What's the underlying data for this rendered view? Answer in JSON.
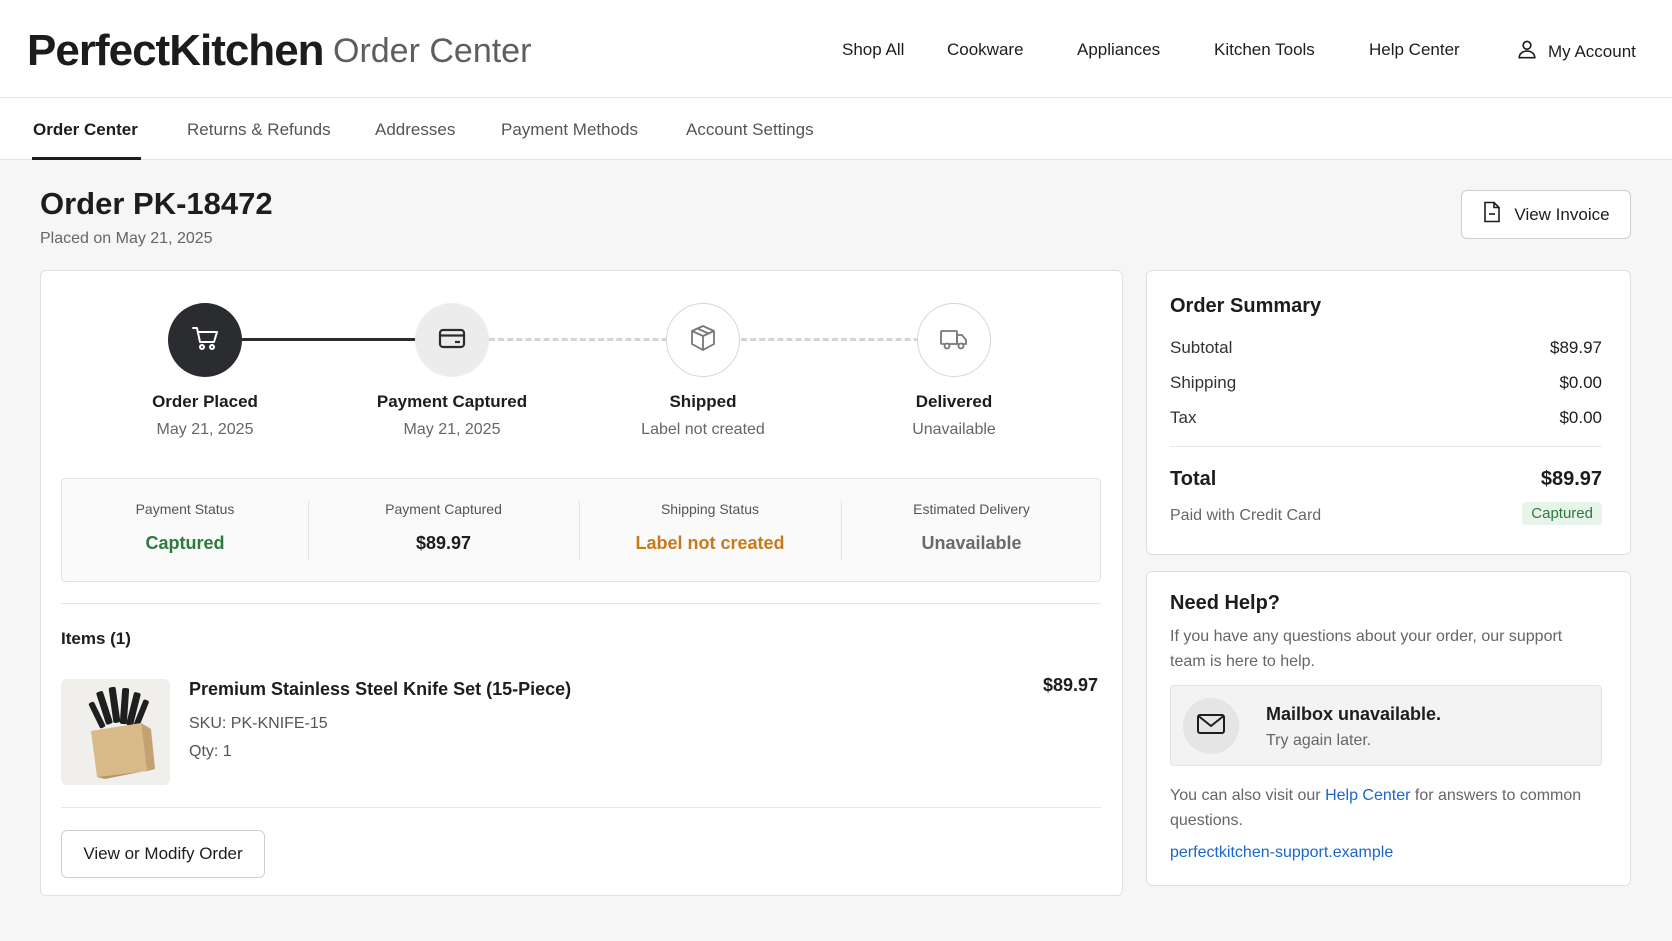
{
  "header": {
    "brand": "PerfectKitchen",
    "brand_sub": "Order Center",
    "nav": [
      "Shop All",
      "Cookware",
      "Appliances",
      "Kitchen Tools",
      "Help Center"
    ],
    "account_label": "My Account",
    "account_icon": "user-icon"
  },
  "subnav": {
    "tabs": [
      "Order Center",
      "Returns & Refunds",
      "Addresses",
      "Payment Methods",
      "Account Settings"
    ],
    "active": "Order Center"
  },
  "order": {
    "title": "Order PK-18472",
    "placed": "Placed on May 21, 2025",
    "invoice_label": "View Invoice"
  },
  "tracker": {
    "steps": [
      {
        "label": "Order Placed",
        "sub": "May 21, 2025",
        "icon": "cart-icon",
        "state": "done"
      },
      {
        "label": "Payment Captured",
        "sub": "May 21, 2025",
        "icon": "credit-card-icon",
        "state": "current"
      },
      {
        "label": "Shipped",
        "sub": "Label not created",
        "icon": "box-icon",
        "state": "pending"
      },
      {
        "label": "Delivered",
        "sub": "Unavailable",
        "icon": "truck-icon",
        "state": "pending"
      }
    ]
  },
  "status": [
    {
      "label": "Payment Status",
      "value": "Captured",
      "color": "#2d7a3e"
    },
    {
      "label": "Payment Captured",
      "value": "$89.97",
      "color": "#1d1d1f"
    },
    {
      "label": "Shipping Status",
      "value": "Label not created",
      "color": "#c87a1a"
    },
    {
      "label": "Estimated Delivery",
      "value": "Unavailable",
      "color": "#6a6a6a"
    }
  ],
  "items": {
    "heading": "Items (1)",
    "list": [
      {
        "name": "Premium Stainless Steel Knife Set (15-Piece)",
        "sku": "SKU: PK-KNIFE-15",
        "qty": "Qty: 1",
        "price": "$89.97"
      }
    ],
    "modify_label": "View or Modify Order"
  },
  "summary": {
    "title": "Order Summary",
    "rows": [
      {
        "label": "Subtotal",
        "value": "$89.97"
      },
      {
        "label": "Shipping",
        "value": "$0.00"
      },
      {
        "label": "Tax",
        "value": "$0.00"
      }
    ],
    "total_label": "Total",
    "total_value": "$89.97",
    "paid_with": "Paid with Credit Card",
    "badge": "Captured"
  },
  "help": {
    "title": "Need Help?",
    "text": "If you have any questions about your order, our support team is here to help.",
    "mailbox_title": "Mailbox unavailable.",
    "mailbox_sub": "Try again later.",
    "foot_prefix": "You can also visit our ",
    "foot_link": "Help Center",
    "foot_suffix": " for answers to common questions.",
    "support_link": "perfectkitchen-support.example"
  },
  "colors": {
    "dark": "#2a2c30",
    "success": "#2d7a3e",
    "warning": "#c87a1a",
    "link": "#1a66c9"
  }
}
